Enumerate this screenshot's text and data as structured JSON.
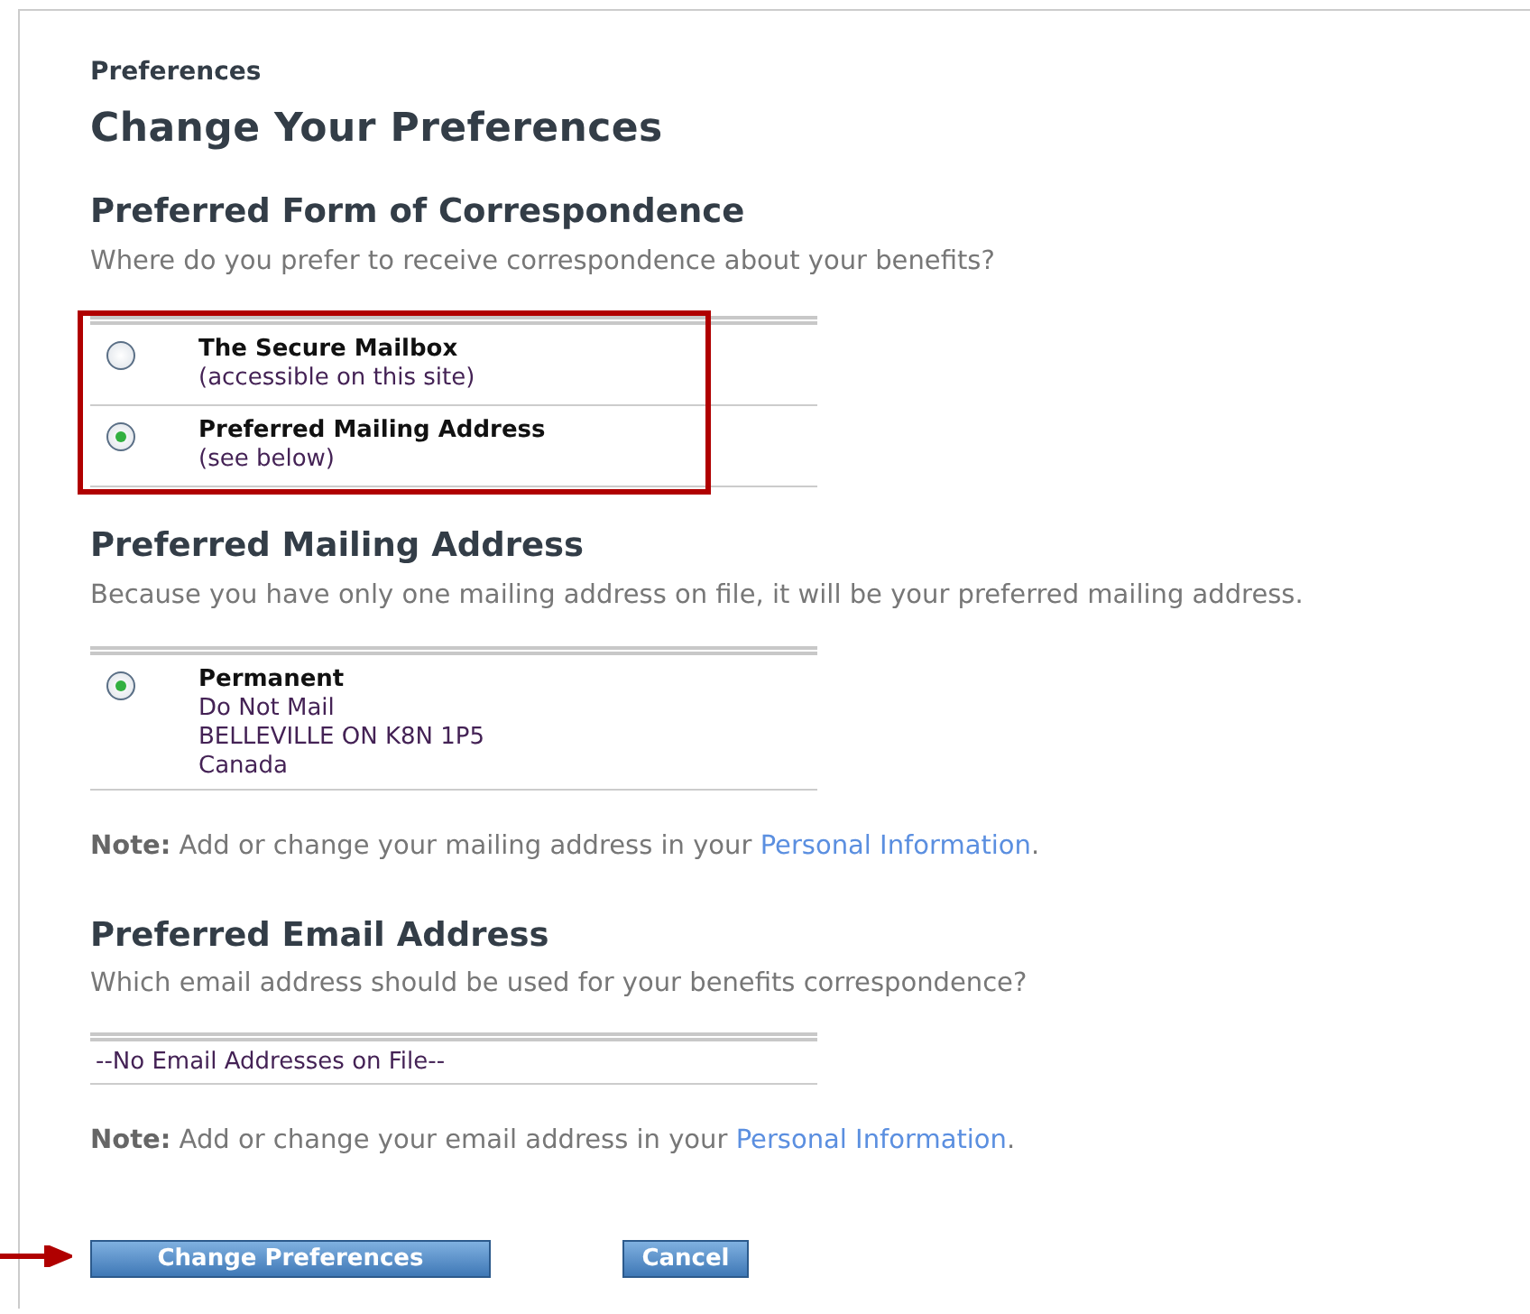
{
  "breadcrumb": "Preferences",
  "title": "Change Your Preferences",
  "correspondence": {
    "heading": "Preferred Form of Correspondence",
    "prompt": "Where do you prefer to receive correspondence about your benefits?",
    "highlighted": true,
    "options": [
      {
        "label": "The Secure Mailbox",
        "detail": "(accessible on this site)",
        "selected": false
      },
      {
        "label": "Preferred Mailing Address",
        "detail": "(see below)",
        "selected": true
      }
    ]
  },
  "mailing": {
    "heading": "Preferred Mailing Address",
    "prompt": "Because you have only one mailing address on file, it will be your preferred mailing address.",
    "addresses": [
      {
        "label": "Permanent",
        "lines": [
          "Do Not Mail",
          "BELLEVILLE ON K8N 1P5",
          "Canada"
        ],
        "selected": true
      }
    ],
    "note": {
      "text": "**Note:** Add or change your mailing address in your ",
      "link": "Personal Information",
      "end": "."
    }
  },
  "email": {
    "heading": "Preferred Email Address",
    "prompt": "Which email address should be used for your benefits correspondence?",
    "entries": [
      "--No Email Addresses on File--"
    ],
    "note": {
      "text": "**Note:** Add or change your email address in your ",
      "link": "Personal Information",
      "end": "."
    }
  },
  "buttons": [
    {
      "label": "Change Preferences",
      "arrow": true
    },
    {
      "label": "Cancel",
      "arrow": false
    }
  ]
}
